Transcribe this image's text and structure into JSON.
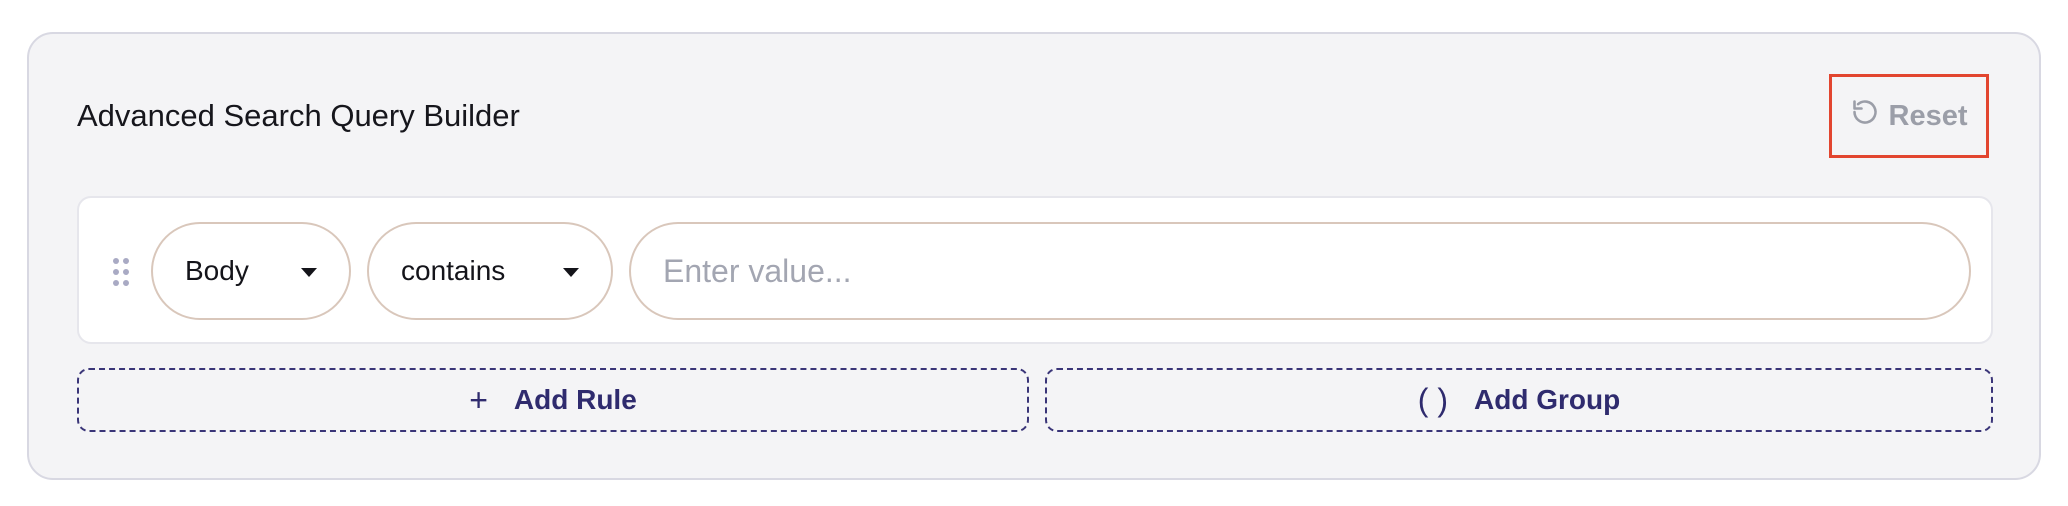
{
  "panel": {
    "title": "Advanced Search Query Builder",
    "reset": {
      "label": "Reset",
      "icon": "rotate-ccw-icon"
    }
  },
  "rule": {
    "field": {
      "selected": "Body"
    },
    "operator": {
      "selected": "contains"
    },
    "value": {
      "current": "",
      "placeholder": "Enter value..."
    }
  },
  "actions": {
    "add_rule": {
      "icon": "+",
      "label": "Add Rule"
    },
    "add_group": {
      "icon": "( )",
      "label": "Add Group"
    }
  },
  "colors": {
    "accent": "#2f2b6e",
    "highlight_border": "#e2452f",
    "muted_text": "#9b9ea8"
  }
}
